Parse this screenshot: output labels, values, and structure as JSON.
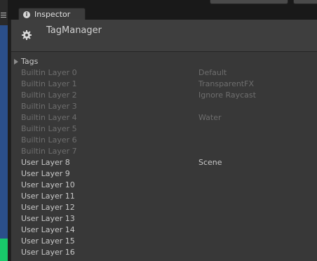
{
  "window": {
    "tab_label": "Inspector",
    "tab_icon": "info-icon"
  },
  "header": {
    "title": "TagManager",
    "icon": "gear-icon"
  },
  "tags": {
    "label": "Tags",
    "expanded": false
  },
  "layers": [
    {
      "name": "Builtin Layer 0",
      "value": "Default",
      "builtin": true
    },
    {
      "name": "Builtin Layer 1",
      "value": "TransparentFX",
      "builtin": true
    },
    {
      "name": "Builtin Layer 2",
      "value": "Ignore Raycast",
      "builtin": true
    },
    {
      "name": "Builtin Layer 3",
      "value": "",
      "builtin": true
    },
    {
      "name": "Builtin Layer 4",
      "value": "Water",
      "builtin": true
    },
    {
      "name": "Builtin Layer 5",
      "value": "",
      "builtin": true
    },
    {
      "name": "Builtin Layer 6",
      "value": "",
      "builtin": true
    },
    {
      "name": "Builtin Layer 7",
      "value": "",
      "builtin": true
    },
    {
      "name": "User Layer 8",
      "value": "Scene",
      "builtin": false
    },
    {
      "name": "User Layer 9",
      "value": "",
      "builtin": false
    },
    {
      "name": "User Layer 10",
      "value": "",
      "builtin": false
    },
    {
      "name": "User Layer 11",
      "value": "",
      "builtin": false
    },
    {
      "name": "User Layer 12",
      "value": "",
      "builtin": false
    },
    {
      "name": "User Layer 13",
      "value": "",
      "builtin": false
    },
    {
      "name": "User Layer 14",
      "value": "",
      "builtin": false
    },
    {
      "name": "User Layer 15",
      "value": "",
      "builtin": false
    },
    {
      "name": "User Layer 16",
      "value": "",
      "builtin": false
    }
  ],
  "colors": {
    "panel_bg": "#383838",
    "builtin_text": "#6e6e6e",
    "user_text": "#c8c8c8",
    "scene_strip": "#2b4f8a",
    "scene_green": "#19c86a"
  }
}
